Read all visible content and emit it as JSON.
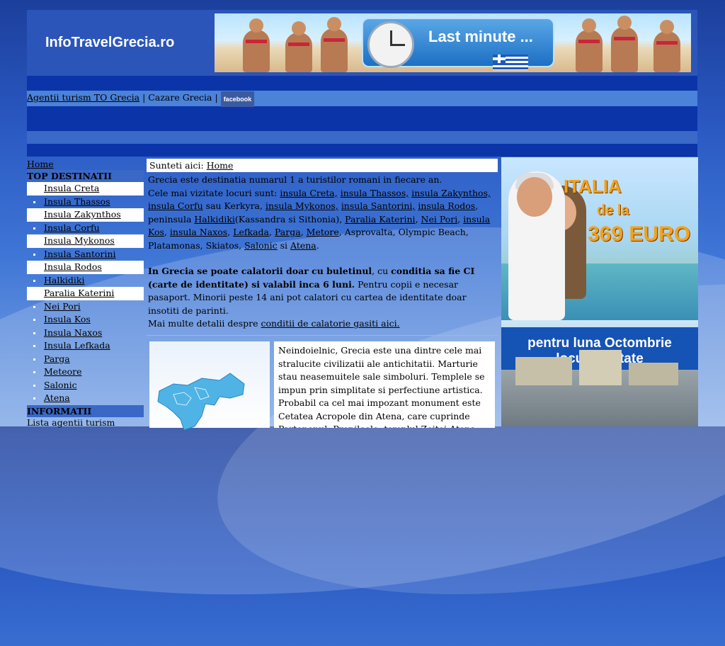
{
  "site": {
    "logo": "InfoTravelGrecia.ro",
    "banner_text": "Last minute ..."
  },
  "nav": {
    "link1": "Agentii turism TO Grecia",
    "sep1": " | ",
    "link2": "Cazare Grecia",
    "sep2": " | ",
    "facebook": "facebook"
  },
  "sidebar": {
    "home": "Home",
    "top_title": "TOP DESTINATII",
    "items": [
      {
        "label": "Insula Creta"
      },
      {
        "label": "Insula Thassos"
      },
      {
        "label": "Insula Zakynthos"
      },
      {
        "label": "Insula Corfu"
      },
      {
        "label": "Insula Mykonos"
      },
      {
        "label": "Insula Santorini"
      },
      {
        "label": "Insula Rodos"
      },
      {
        "label": "Halkidiki"
      },
      {
        "label": "Paralia Katerini"
      },
      {
        "label": "Nei Pori"
      },
      {
        "label": "Insula Kos"
      },
      {
        "label": "Insula Naxos"
      },
      {
        "label": "Insula Lefkada"
      },
      {
        "label": "Parga"
      },
      {
        "label": "Meteore"
      },
      {
        "label": "Salonic"
      },
      {
        "label": "Atena"
      }
    ],
    "info_title": "INFORMATII",
    "info_first": "Lista agentii turism"
  },
  "main": {
    "crumb_label": "Sunteti aici:",
    "crumb_link": "Home",
    "line1": "Grecia este destinatia numarul 1 a turistilor romani in fiecare an.",
    "line2_start": "Cele mai vizitate locuri sunt:",
    "links": {
      "creta": "insula Creta,",
      "thassos": "insula Thassos,",
      "zakynthos": "insula Zakynthos,",
      "corfu": "insula Corfu",
      "kerkyra": " sau Kerkyra, ",
      "mykonos": "insula Mykonos,",
      "santorini": "insula Santorini,",
      "rodos": "insula Rodos",
      "peninsula": ", peninsula ",
      "halkidiki": "Halkidiki",
      "halk_paren": "(Kassandra si Sithonia), ",
      "katerini": "Paralia Katerini",
      "neipori": "Nei Pori",
      "kos": "insula Kos",
      "naxos": "insula Naxos",
      "lefkada": "Lefkada",
      "parga": "Parga",
      "metore": "Metore",
      "rest": ", Asprovalta, Olympic Beach, Platamonas, Skiatos, ",
      "salonic": "Salonic",
      "si": " si ",
      "atena": "Atena"
    },
    "bold1": "In Grecia se poate calatorii doar cu buletinul",
    "mid1": ", cu ",
    "bold2": "conditia sa fie CI (carte de identitate) si valabil inca 6 luni.",
    "after_bold": " Pentru copii e necesar pasaport. Minorii peste 14 ani pot calatori cu cartea de identitate doar insotiti de parinti.",
    "more_prefix": "Mai multe detalii despre ",
    "more_link": "conditii de calatorie gasiti aici.",
    "desc": "Neindoielnic, Grecia este una dintre cele mai stralucite civilizatii ale antichitatii. Marturie stau neasemuitele sale simboluri. Templele se impun prin simplitate si perfectiune artistica. Probabil ca cel mai impozant monument este Cetatea Acropole din Atena, care cuprinde Partenonul, Propileele, templul Zeitei Atena Nike, Erehteionul si multe alte constructii."
  },
  "ad": {
    "title": "ITALIA",
    "de_la": "de la",
    "price": "369 EURO",
    "line1": "pentru luna Octombrie",
    "line2": "locuri limitate"
  },
  "colors": {
    "header_bg": "#2b55b8",
    "nav_bg": "#0a34a8",
    "nav_links_bg": "#4b82da",
    "section_title_bg": "#3a68c6",
    "ad_text": "#f4a21a"
  }
}
